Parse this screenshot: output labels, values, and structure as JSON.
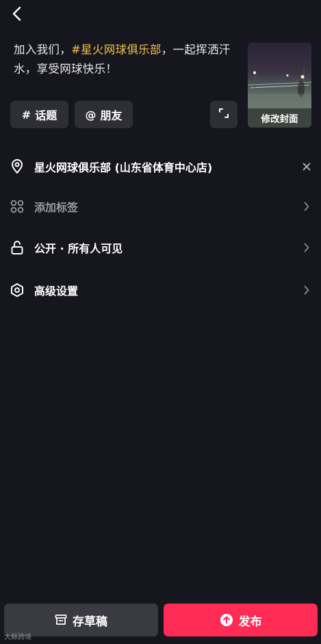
{
  "caption": {
    "before": "加入我们，",
    "hashtag": "#星火网球俱乐部",
    "after": "，一起挥洒汗水，享受网球快乐！"
  },
  "cover": {
    "label": "修改封面"
  },
  "chips": {
    "topic": {
      "symbol": "#",
      "label": "话题"
    },
    "friend": {
      "symbol": "@",
      "label": "朋友"
    }
  },
  "rows": {
    "location": "星火网球俱乐部 (山东省体育中心店)",
    "tags": "添加标签",
    "visibility": "公开 · 所有人可见",
    "advanced": "高级设置"
  },
  "buttons": {
    "draft": "存草稿",
    "publish": "发布"
  },
  "watermark": "大鲸跨境",
  "colors": {
    "background": "#16161f",
    "hashtag": "#f2c14e",
    "publish": "#fe2c55",
    "chip": "#2e2e37"
  },
  "icons": {
    "back": "chevron-left-icon",
    "expand": "expand-icon",
    "location": "location-pin-icon",
    "close": "close-icon",
    "tags": "grid-icon",
    "visibility": "unlock-icon",
    "advanced": "hexagon-settings-icon",
    "chevron": "chevron-right-icon",
    "draft": "archive-icon",
    "publish": "upload-circle-icon"
  }
}
